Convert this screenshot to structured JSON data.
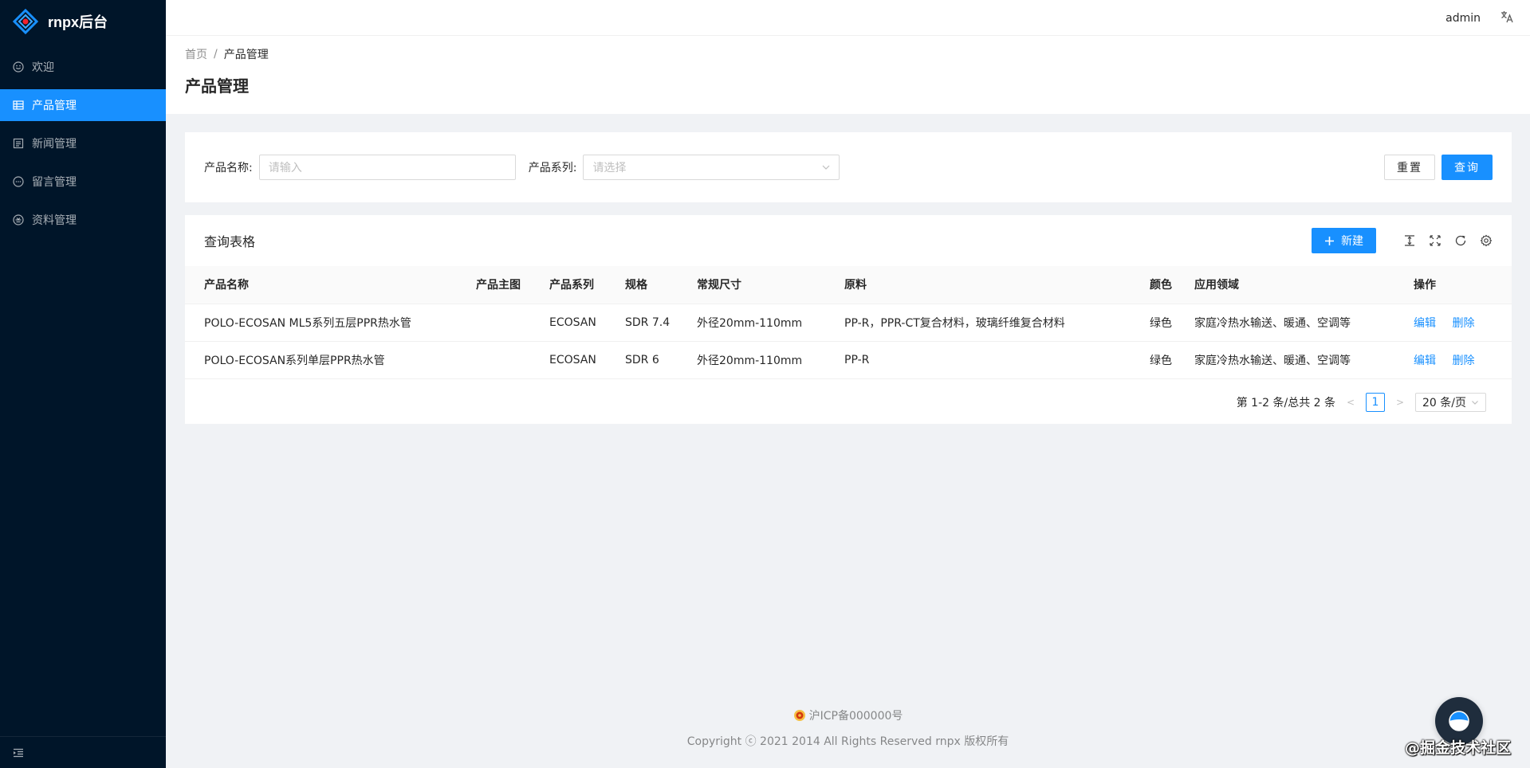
{
  "app": {
    "title": "rnpx后台"
  },
  "sidebar": {
    "items": [
      {
        "label": "欢迎",
        "icon": "smile-icon"
      },
      {
        "label": "产品管理",
        "icon": "table-icon",
        "active": true
      },
      {
        "label": "新闻管理",
        "icon": "profile-icon"
      },
      {
        "label": "留言管理",
        "icon": "message-icon"
      },
      {
        "label": "资料管理",
        "icon": "file-icon"
      }
    ]
  },
  "header": {
    "user": "admin",
    "lang_icon": "translation-icon"
  },
  "breadcrumb": {
    "home": "首页",
    "separator": "/",
    "current": "产品管理"
  },
  "page": {
    "title": "产品管理"
  },
  "search": {
    "name_label": "产品名称:",
    "name_placeholder": "请输入",
    "series_label": "产品系列:",
    "series_placeholder": "请选择",
    "reset": "重置",
    "query": "查询"
  },
  "table": {
    "title": "查询表格",
    "new_button": "新建",
    "columns": [
      "产品名称",
      "产品主图",
      "产品系列",
      "规格",
      "常规尺寸",
      "原料",
      "颜色",
      "应用领域",
      "操作"
    ],
    "rows": [
      {
        "name": "POLO-ECOSAN ML5系列五层PPR热水管",
        "image": "",
        "series": "ECOSAN",
        "spec": "SDR 7.4",
        "size": "外径20mm-110mm",
        "material": "PP-R，PPR-CT复合材料，玻璃纤维复合材料",
        "color": "绿色",
        "application": "家庭冷热水输送、暖通、空调等",
        "edit": "编辑",
        "delete": "删除"
      },
      {
        "name": "POLO-ECOSAN系列单层PPR热水管",
        "image": "",
        "series": "ECOSAN",
        "spec": "SDR 6",
        "size": "外径20mm-110mm",
        "material": "PP-R",
        "color": "绿色",
        "application": "家庭冷热水输送、暖通、空调等",
        "edit": "编辑",
        "delete": "删除"
      }
    ]
  },
  "pagination": {
    "summary": "第 1-2 条/总共 2 条",
    "current": "1",
    "page_size": "20 条/页"
  },
  "footer": {
    "icp": "沪ICP备000000号",
    "copyright": "Copyright ⓒ 2021 2014 All Rights Reserved rnpx 版权所有"
  },
  "watermark": "@掘金技术社区",
  "colors": {
    "primary": "#1890ff",
    "sider": "#001529",
    "bg": "#f0f2f5"
  }
}
